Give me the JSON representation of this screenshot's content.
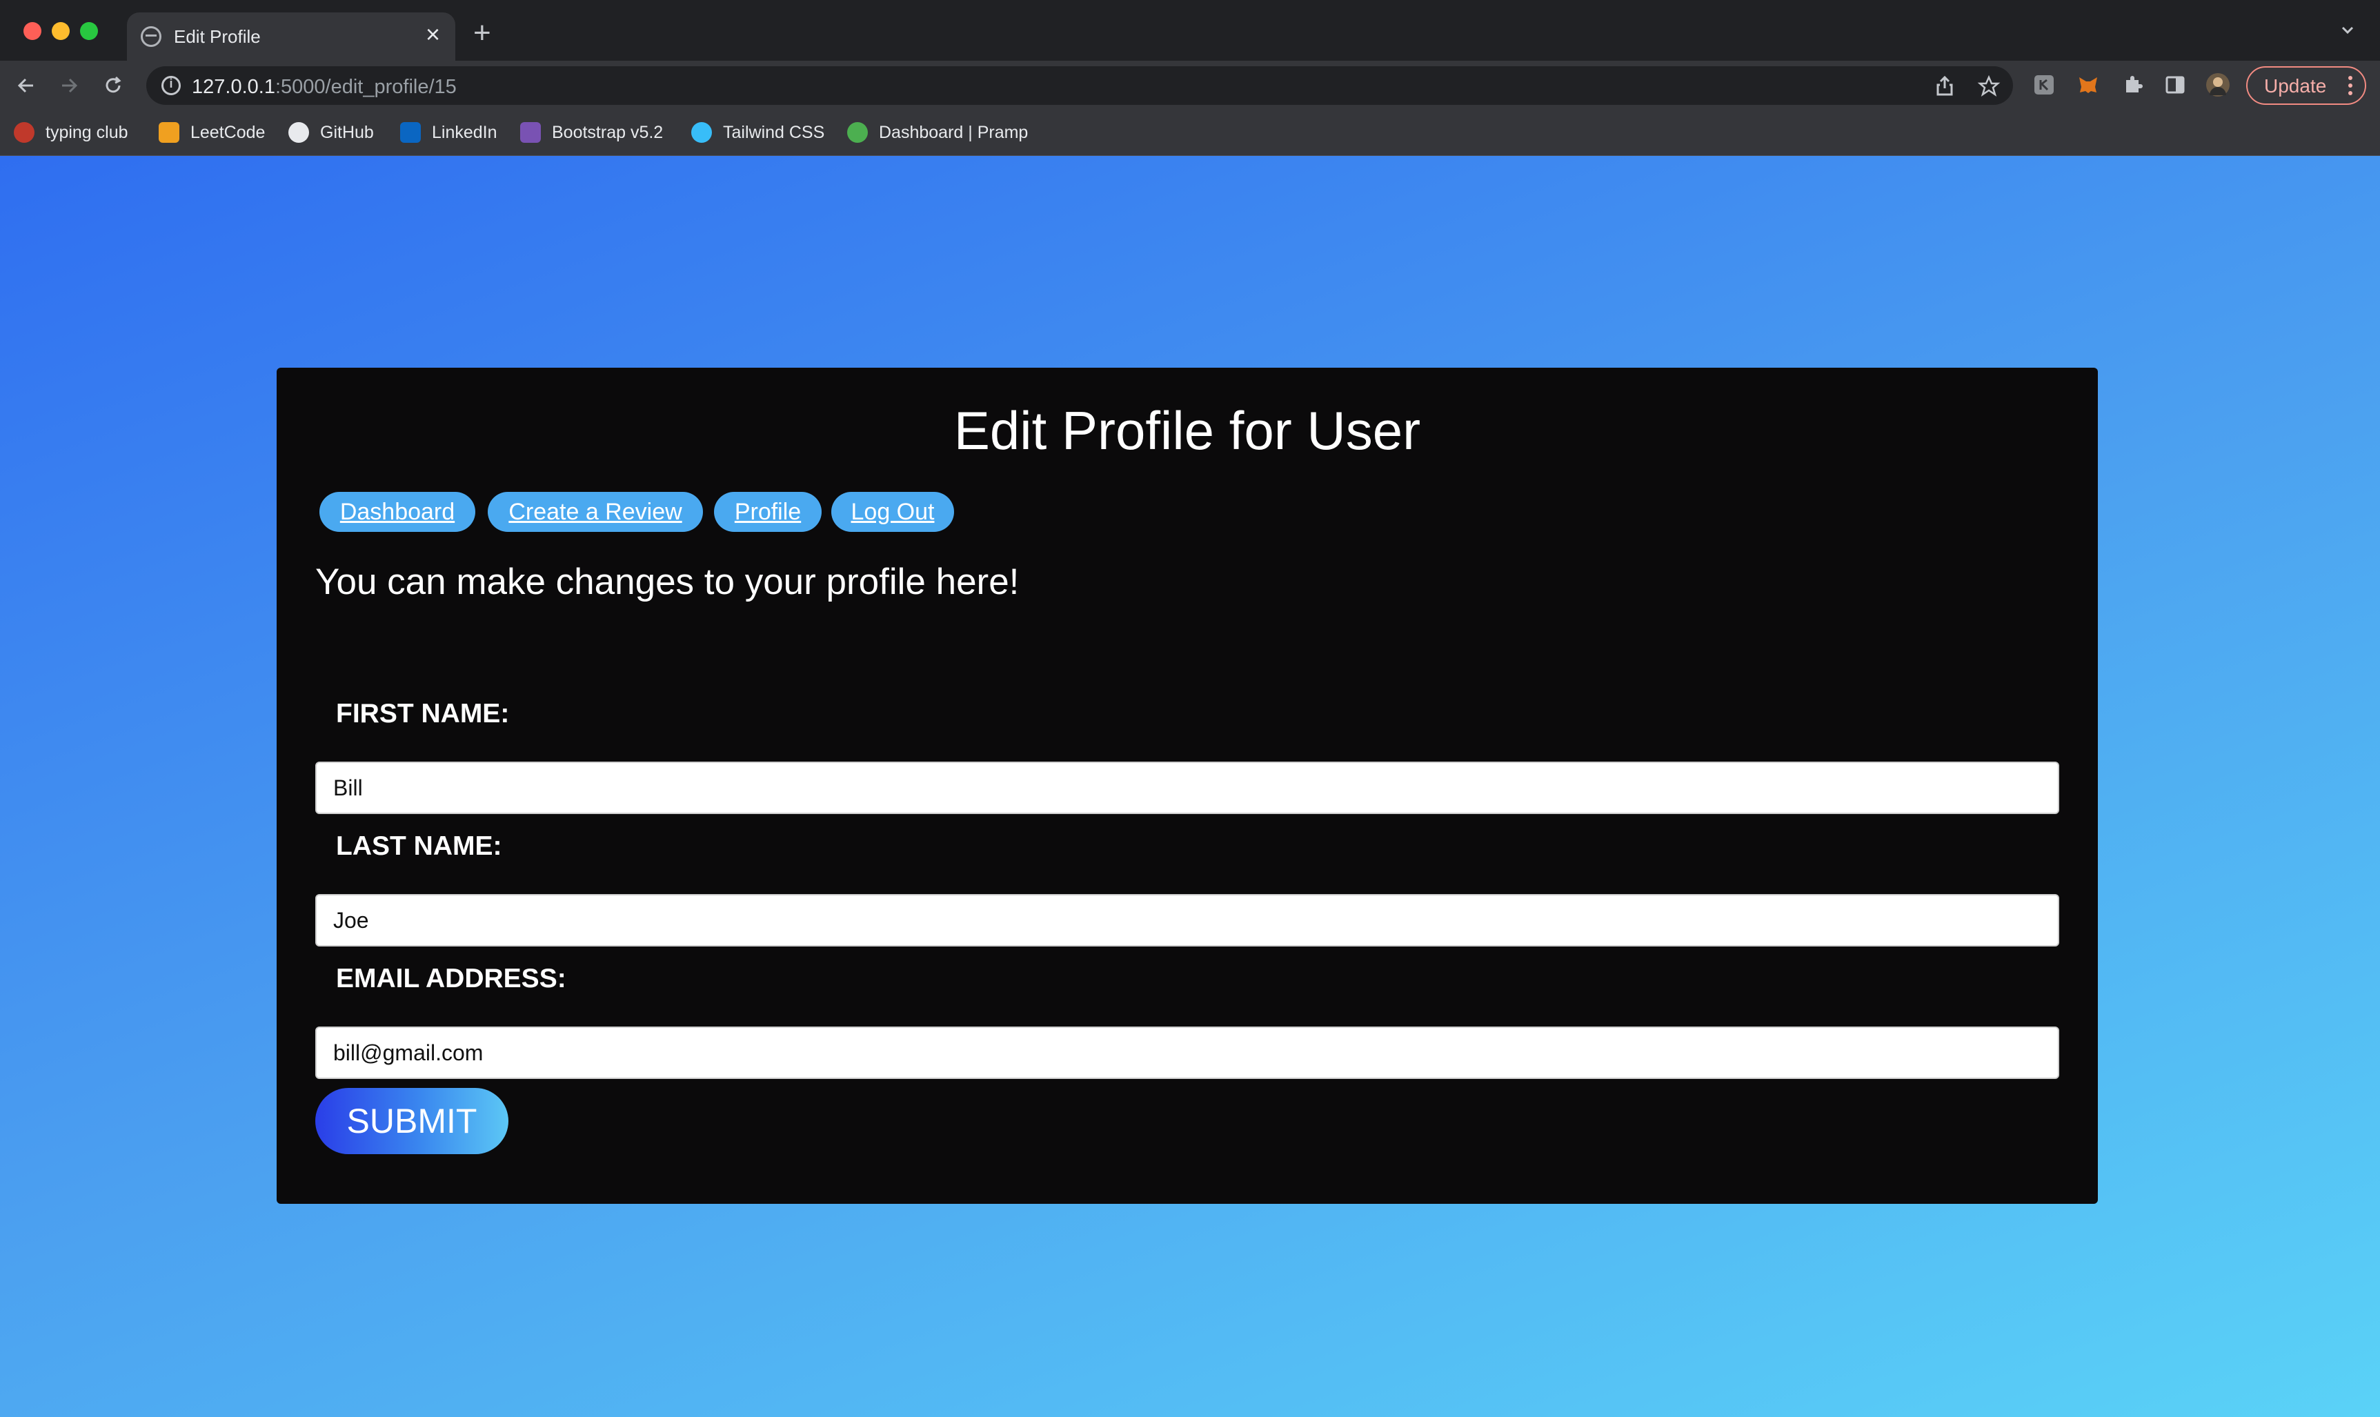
{
  "browser": {
    "tab_title": "Edit Profile",
    "url_host": "127.0.0.1",
    "url_path": ":5000/edit_profile/15",
    "update_label": "Update",
    "bookmarks": [
      {
        "label": "typing club",
        "icon": "typing-club-icon",
        "color": "#c0392b"
      },
      {
        "label": "LeetCode",
        "icon": "leetcode-icon",
        "color": "#f0a020"
      },
      {
        "label": "GitHub",
        "icon": "github-icon",
        "color": "#e8eaed"
      },
      {
        "label": "LinkedIn",
        "icon": "linkedin-icon",
        "color": "#0a66c2"
      },
      {
        "label": "Bootstrap v5.2",
        "icon": "bootstrap-icon",
        "color": "#7952b3"
      },
      {
        "label": "Tailwind CSS",
        "icon": "tailwind-icon",
        "color": "#38bdf8"
      },
      {
        "label": "Dashboard | Pramp",
        "icon": "pramp-icon",
        "color": "#4caf50"
      }
    ]
  },
  "page": {
    "title": "Edit Profile for User",
    "nav": [
      "Dashboard",
      "Create a Review",
      "Profile",
      "Log Out"
    ],
    "intro": "You can make changes to your profile here!",
    "form": {
      "first_name_label": "FIRST NAME:",
      "first_name_value": "Bill",
      "last_name_label": "LAST NAME:",
      "last_name_value": "Joe",
      "email_label": "EMAIL ADDRESS:",
      "email_value": "bill@gmail.com",
      "submit_label": "SUBMIT"
    }
  },
  "colors": {
    "card_background": "#0b0a0b",
    "nav_pill": "#4aa9f0",
    "gradient_start": "#2f6ef0",
    "gradient_end": "#5ad2f7"
  }
}
